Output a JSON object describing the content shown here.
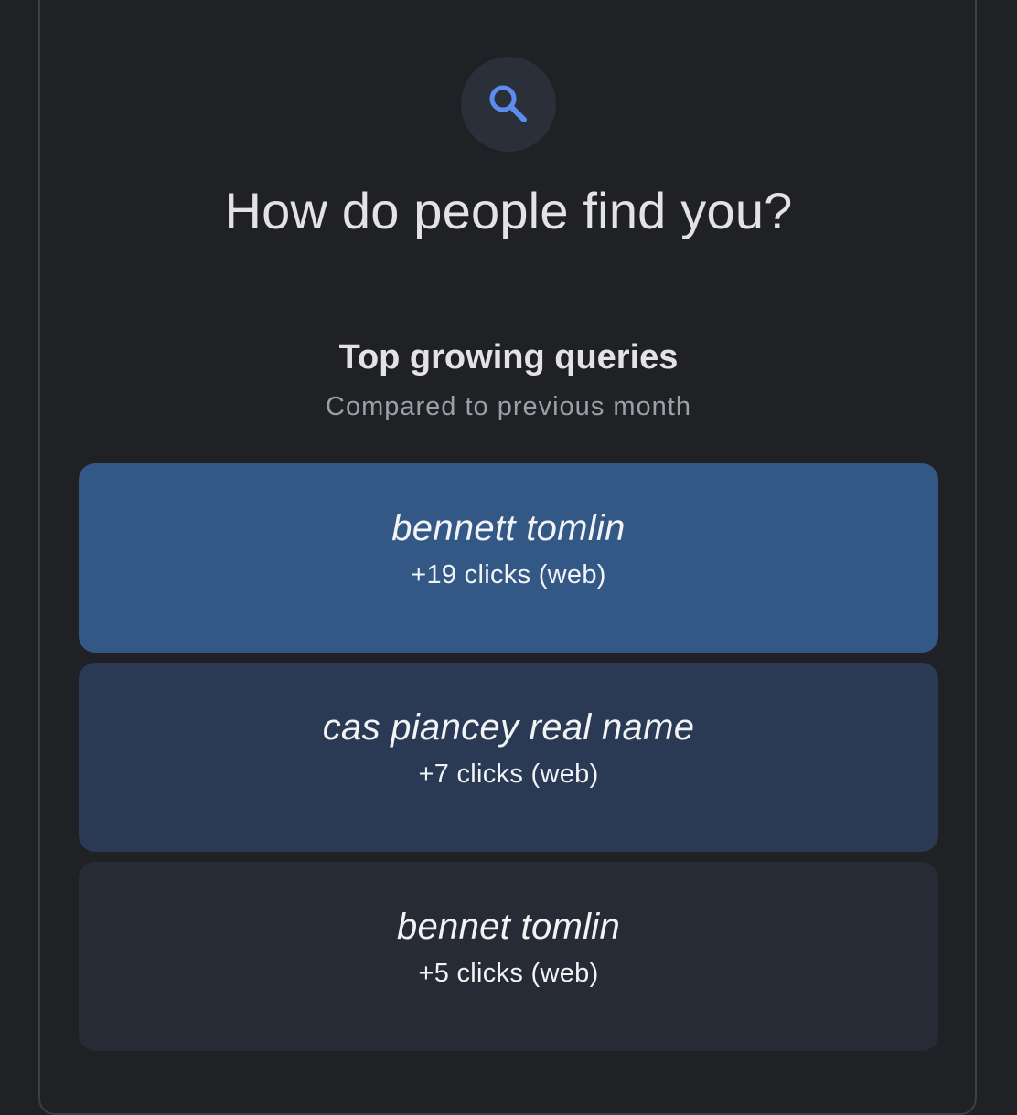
{
  "header": {
    "icon": "search-icon",
    "accent_color": "#5b8def",
    "title": "How do people find you?"
  },
  "section": {
    "title": "Top growing queries",
    "subtitle": "Compared to previous month"
  },
  "queries": [
    {
      "query": "bennett tomlin",
      "stat": "+19 clicks (web)",
      "color": "#335886"
    },
    {
      "query": "cas piancey real name",
      "stat": "+7 clicks (web)",
      "color": "#2a3a54"
    },
    {
      "query": "bennet tomlin",
      "stat": "+5 clicks (web)",
      "color": "#272b35"
    }
  ]
}
